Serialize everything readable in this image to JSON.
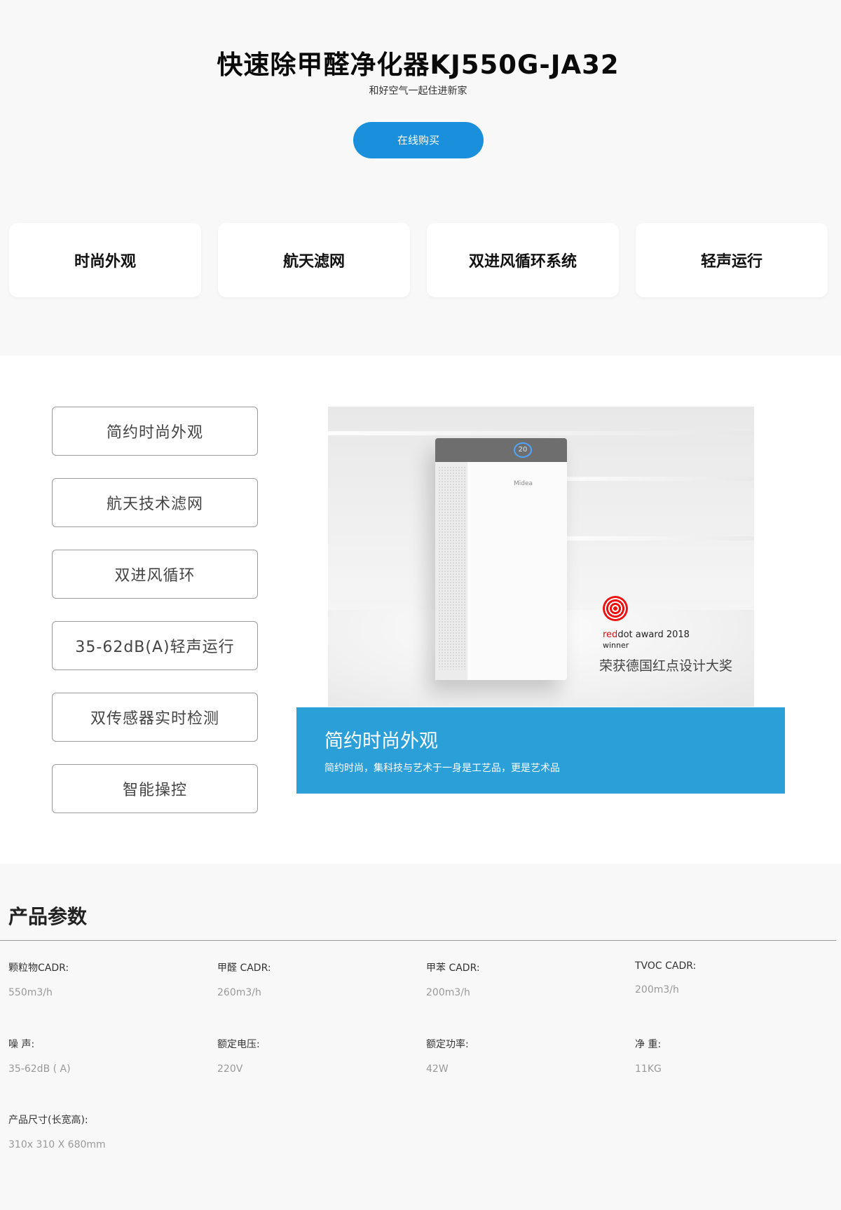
{
  "hero": {
    "title": "快速除甲醛净化器KJ550G-JA32",
    "subtitle": "和好空气一起住进新家",
    "buy_label": "在线购买"
  },
  "feature_cards": [
    {
      "label": "时尚外观"
    },
    {
      "label": "航天滤网"
    },
    {
      "label": "双进风循环系统"
    },
    {
      "label": "轻声运行"
    }
  ],
  "detail": {
    "menu": [
      {
        "label": "简约时尚外观"
      },
      {
        "label": "航天技术滤网"
      },
      {
        "label": "双进风循环"
      },
      {
        "label": "35-62dB(A)轻声运行"
      },
      {
        "label": "双传感器实时检测"
      },
      {
        "label": "智能操控"
      }
    ],
    "photo": {
      "display_value": "20",
      "brand": "Midea",
      "award_red": "red",
      "award_dot": "dot",
      "award_rest": " award 2018",
      "award_winner": "winner",
      "award_cn": "荣获德国红点设计大奖"
    },
    "caption": {
      "title": "简约时尚外观",
      "description": "简约时尚，集科技与艺术于一身是工艺品，更是艺术品"
    }
  },
  "specs": {
    "title": "产品参数",
    "items": [
      {
        "label": "颗粒物CADR:",
        "value": "550m3/h"
      },
      {
        "label": "甲醛 CADR:",
        "value": "260m3/h"
      },
      {
        "label": "甲苯 CADR:",
        "value": "200m3/h"
      },
      {
        "label": "TVOC CADR:",
        "value": "200m3/h"
      },
      {
        "label": "噪 声:",
        "value": "35-62dB ( A)"
      },
      {
        "label": "额定电压:",
        "value": "220V"
      },
      {
        "label": "额定功率:",
        "value": "42W"
      },
      {
        "label": "净 重:",
        "value": "11KG"
      },
      {
        "label": "产品尺寸(长宽高):",
        "value": "310x 310 X 680mm"
      }
    ]
  },
  "colors": {
    "accent": "#1a8fdc",
    "caption_bg": "#2ba0d8",
    "page_bg": "#f8f8f8"
  }
}
